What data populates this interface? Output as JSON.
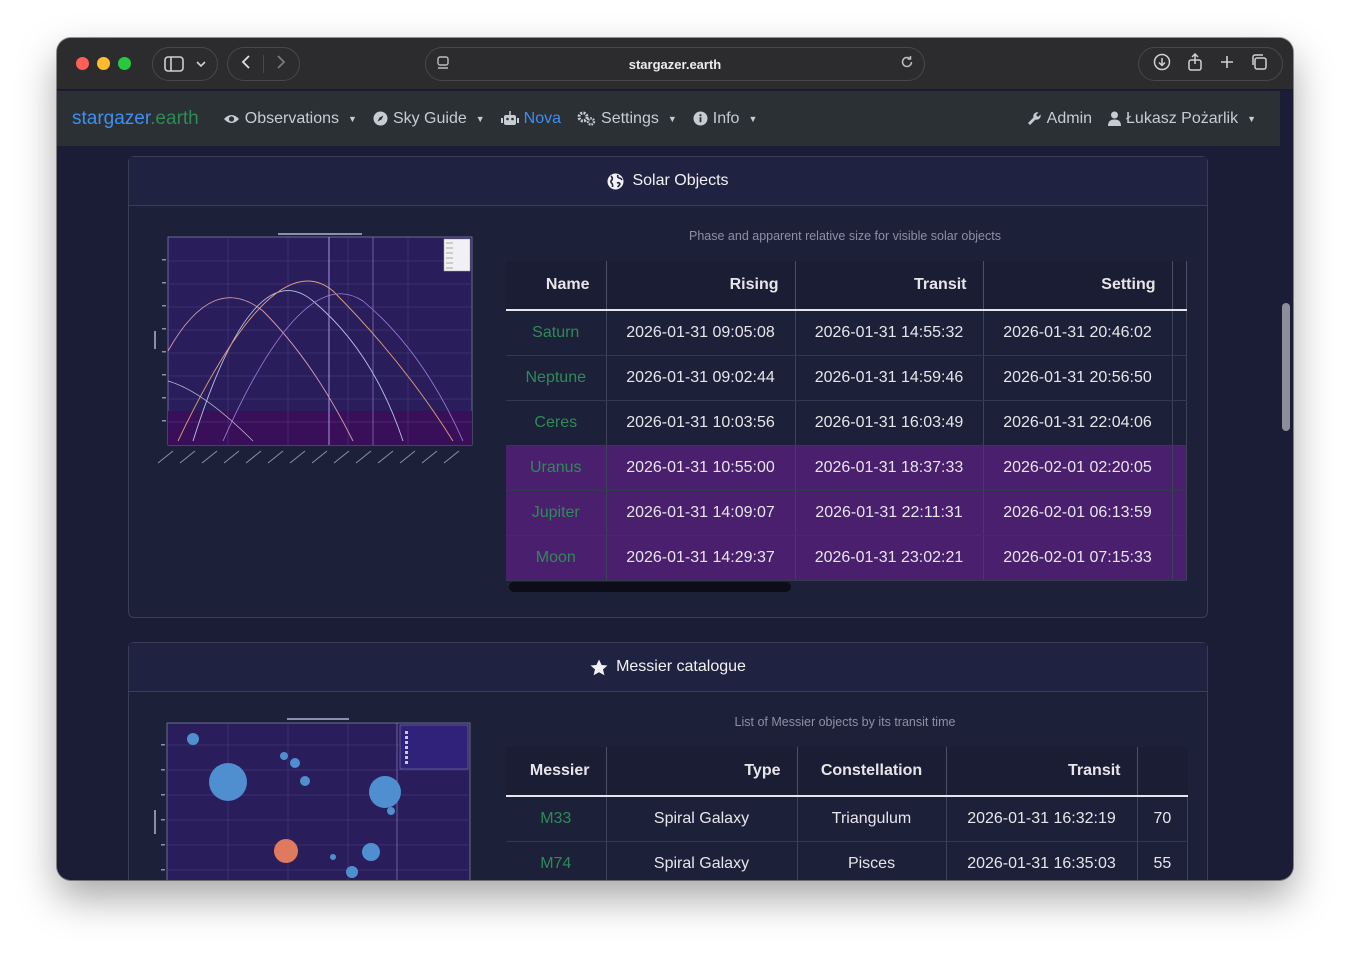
{
  "browser": {
    "url": "stargazer.earth"
  },
  "navbar": {
    "brand_name": "stargazer",
    "brand_tld": ".earth",
    "items": [
      {
        "label": "Observations"
      },
      {
        "label": "Sky Guide"
      },
      {
        "label": "Nova"
      },
      {
        "label": "Settings"
      },
      {
        "label": "Info"
      }
    ],
    "admin": "Admin",
    "user": "Łukasz Pożarlik"
  },
  "solar": {
    "title": "Solar Objects",
    "caption": "Phase and apparent relative size for visible solar objects",
    "columns": [
      "Name",
      "Rising",
      "Transit",
      "Setting"
    ],
    "rows": [
      {
        "name": "Saturn",
        "rising": "2026-01-31 09:05:08",
        "transit": "2026-01-31 14:55:32",
        "setting": "2026-01-31 20:46:02",
        "highlight": false
      },
      {
        "name": "Neptune",
        "rising": "2026-01-31 09:02:44",
        "transit": "2026-01-31 14:59:46",
        "setting": "2026-01-31 20:56:50",
        "highlight": false
      },
      {
        "name": "Ceres",
        "rising": "2026-01-31 10:03:56",
        "transit": "2026-01-31 16:03:49",
        "setting": "2026-01-31 22:04:06",
        "highlight": false
      },
      {
        "name": "Uranus",
        "rising": "2026-01-31 10:55:00",
        "transit": "2026-01-31 18:37:33",
        "setting": "2026-02-01 02:20:05",
        "highlight": true
      },
      {
        "name": "Jupiter",
        "rising": "2026-01-31 14:09:07",
        "transit": "2026-01-31 22:11:31",
        "setting": "2026-02-01 06:13:59",
        "highlight": true
      },
      {
        "name": "Moon",
        "rising": "2026-01-31 14:29:37",
        "transit": "2026-01-31 23:02:21",
        "setting": "2026-02-01 07:15:33",
        "highlight": true
      }
    ]
  },
  "messier": {
    "title": "Messier catalogue",
    "caption": "List of Messier objects by its transit time",
    "columns": [
      "Messier",
      "Type",
      "Constellation",
      "Transit"
    ],
    "rows": [
      {
        "id": "M33",
        "type": "Spiral Galaxy",
        "constellation": "Triangulum",
        "transit": "2026-01-31 16:32:19",
        "extra": "70"
      },
      {
        "id": "M74",
        "type": "Spiral Galaxy",
        "constellation": "Pisces",
        "transit": "2026-01-31 16:35:03",
        "extra": "55"
      }
    ]
  },
  "colors": {
    "brand": "#3f8ef0",
    "link": "#2e8b57",
    "highlight_row": "#4a1f6e",
    "background": "#1a1d35"
  },
  "icons": {
    "observations": "eye-icon",
    "sky_guide": "compass-icon",
    "nova": "robot-icon",
    "settings": "gears-icon",
    "info": "info-icon",
    "admin": "wrench-icon",
    "user": "user-icon",
    "solar": "globe-icon",
    "messier": "star-icon"
  }
}
